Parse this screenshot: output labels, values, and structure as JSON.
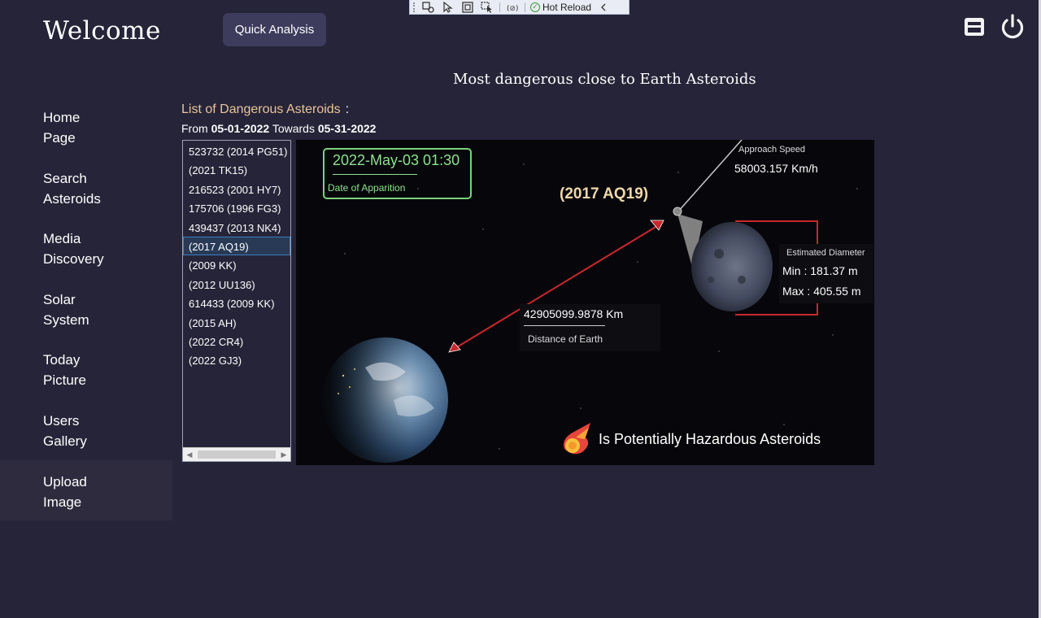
{
  "devbar": {
    "hot_reload_label": "Hot Reload"
  },
  "header": {
    "welcome": "Welcome",
    "quick_analysis_label": "Quick Analysis",
    "page_title": "Most dangerous close to Earth Asteroids"
  },
  "sidebar": {
    "items": [
      {
        "line1": "Home",
        "line2": "Page"
      },
      {
        "line1": "Search",
        "line2": "Asteroids"
      },
      {
        "line1": "Media",
        "line2": "Discovery"
      },
      {
        "line1": "Solar",
        "line2": "System"
      },
      {
        "line1": "Today",
        "line2": "Picture"
      },
      {
        "line1": "Users",
        "line2": "Gallery"
      },
      {
        "line1": "Upload",
        "line2": "Image"
      }
    ],
    "active_index": 6
  },
  "list": {
    "heading": "List of Dangerous Asteroids",
    "heading_colon": ":",
    "from_label": "From",
    "from_date": "05-01-2022",
    "towards_label": "Towards",
    "to_date": "05-31-2022",
    "items": [
      "523732 (2014 PG51)",
      "(2021 TK15)",
      "216523 (2001 HY7)",
      "175706 (1996 FG3)",
      "439437 (2013 NK4)",
      "(2017 AQ19)",
      "(2009 KK)",
      "(2012 UU136)",
      "614433 (2009 KK)",
      "(2015 AH)",
      "(2022 CR4)",
      "(2022 GJ3)"
    ],
    "selected_index": 5
  },
  "detail": {
    "apparition_date": "2022-May-03 01:30",
    "apparition_caption": "Date of Apparition",
    "asteroid_name": "(2017 AQ19)",
    "speed_caption": "Approach Speed",
    "speed_value": "58003.157 Km/h",
    "distance_value": "42905099.9878 Km",
    "distance_caption": "Distance of Earth",
    "diameter_caption": "Estimated Diameter",
    "diameter_min": "Min : 181.37 m",
    "diameter_max": "Max : 405.55 m",
    "hazard_text": "Is Potentially Hazardous Asteroids"
  },
  "colors": {
    "background": "#262438",
    "button": "#3e3c5d",
    "heading_accent": "#e9c49a",
    "date_box": "#7bd17d",
    "pointer_red": "#c8272d"
  }
}
